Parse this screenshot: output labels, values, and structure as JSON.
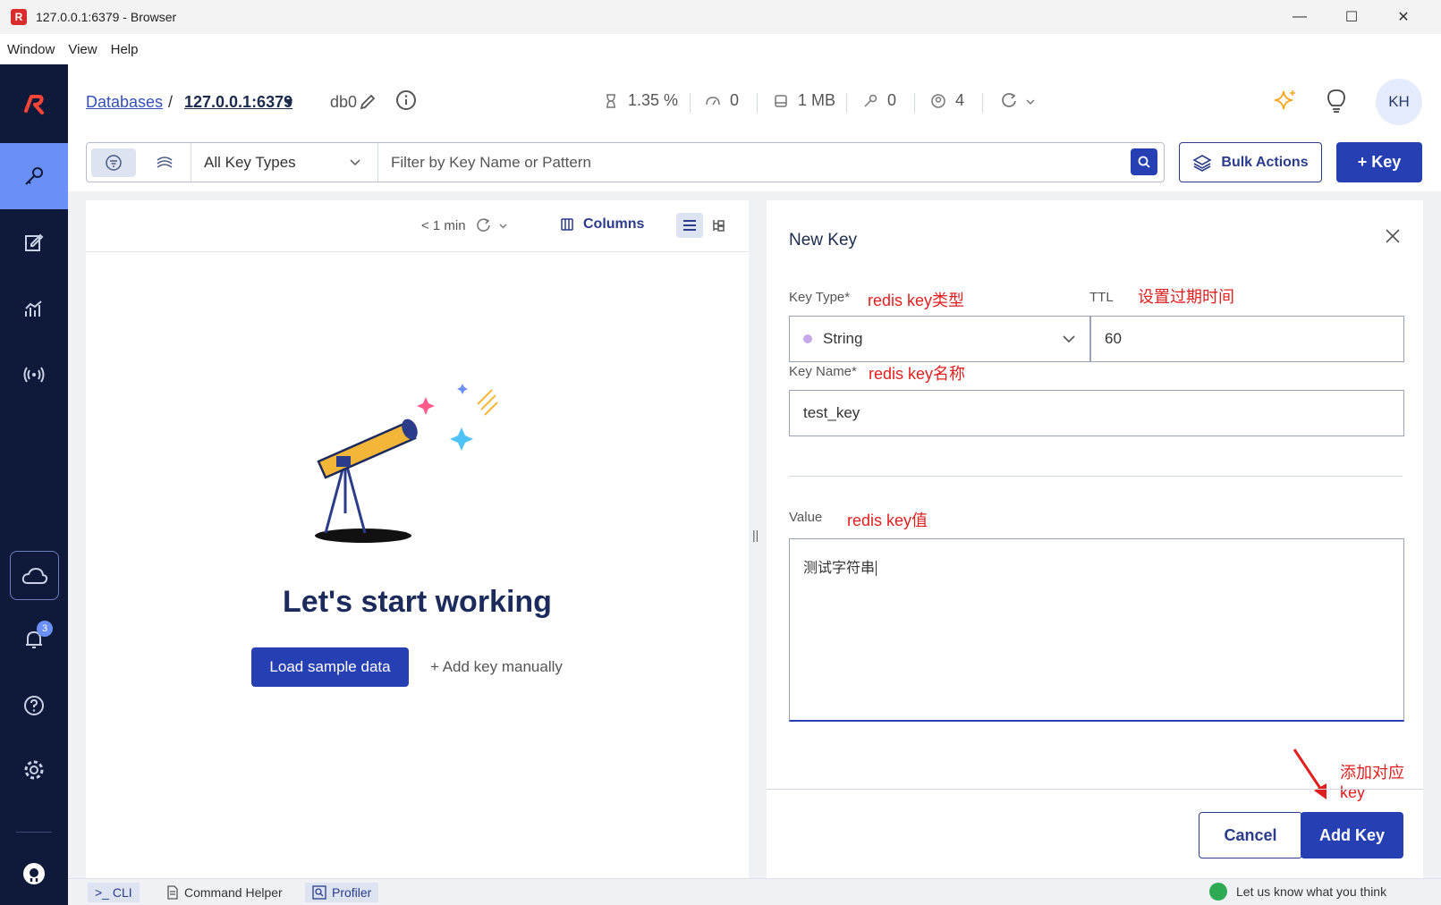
{
  "window": {
    "title": "127.0.0.1:6379 - Browser",
    "app_icon_letter": "R",
    "minimize": "—",
    "maximize": "☐",
    "close": "✕"
  },
  "menu": [
    "Window",
    "View",
    "Help"
  ],
  "header": {
    "breadcrumb_databases": "Databases",
    "breadcrumb_sep": "/",
    "breadcrumb_host": "127.0.0.1:6379",
    "db_index": "db0",
    "stats": {
      "cpu": "1.35 %",
      "ops": "0",
      "memory": "1 MB",
      "keys": "0",
      "clients": "4"
    },
    "avatar": "KH"
  },
  "filter": {
    "key_types": "All Key Types",
    "placeholder": "Filter by Key Name or Pattern",
    "bulk_actions": "Bulk Actions",
    "add_key": "+ Key"
  },
  "list": {
    "refresh_ago": "< 1 min",
    "columns": "Columns",
    "empty_title": "Let's start working",
    "load_sample": "Load sample data",
    "add_manually": "+ Add key manually"
  },
  "new_key": {
    "title": "New Key",
    "key_type_label": "Key Type*",
    "key_type_value": "String",
    "ttl_label": "TTL",
    "ttl_value": "60",
    "key_name_label": "Key Name*",
    "key_name_value": "test_key",
    "value_label": "Value",
    "value_text": "测试字符串",
    "cancel": "Cancel",
    "add_key": "Add Key"
  },
  "annotations": {
    "key_type": "redis key类型",
    "ttl": "设置过期时间",
    "key_name": "redis key名称",
    "value": "redis key值",
    "add": "添加对应key"
  },
  "nav": {
    "notifications_count": "3"
  },
  "bottom": {
    "cli": ">_ CLI",
    "command_helper": "Command Helper",
    "profiler": "Profiler",
    "feedback": "Let us know what you think"
  },
  "colors": {
    "primary": "#2640b4",
    "nav_bg": "#0f1a3a",
    "nav_active": "#6a8ff7",
    "annotation": "#e02020"
  }
}
